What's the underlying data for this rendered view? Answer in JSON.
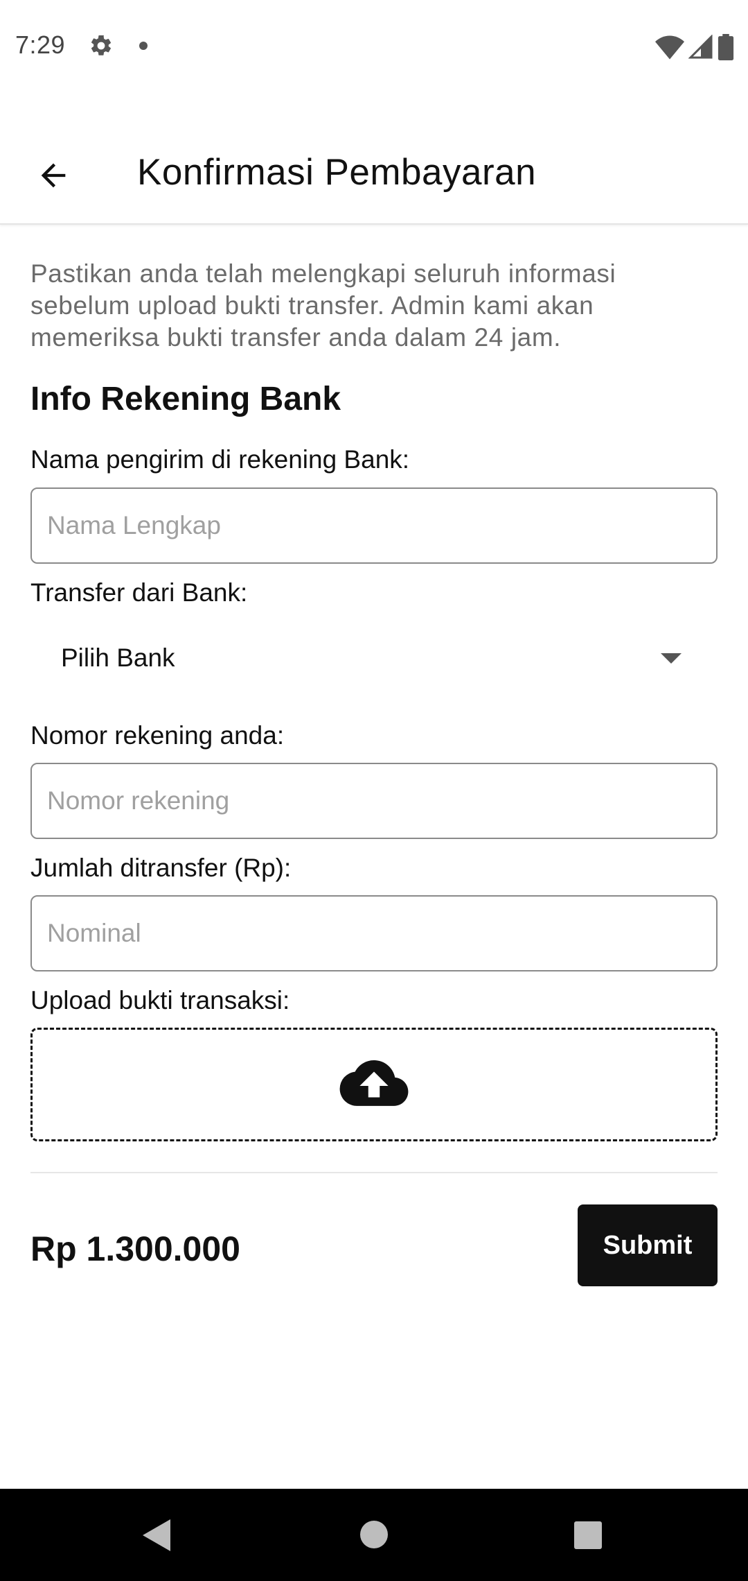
{
  "status_bar": {
    "time": "7:29",
    "icons": [
      "gear-icon",
      "dot-icon",
      "wifi-icon",
      "signal-icon",
      "battery-icon"
    ]
  },
  "app_bar": {
    "title": "Konfirmasi Pembayaran",
    "back_icon": "arrow-back-icon"
  },
  "intro_text": "Pastikan anda telah melengkapi seluruh informasi sebelum upload bukti transfer. Admin kami akan memeriksa bukti transfer anda dalam 24 jam.",
  "section_title": "Info Rekening Bank",
  "form": {
    "sender_name": {
      "label": "Nama pengirim di rekening Bank:",
      "placeholder": "Nama Lengkap",
      "value": ""
    },
    "bank": {
      "label": "Transfer dari Bank:",
      "selected": "Pilih Bank"
    },
    "account_number": {
      "label": "Nomor rekening anda:",
      "placeholder": "Nomor rekening",
      "value": ""
    },
    "amount": {
      "label": "Jumlah ditransfer (Rp):",
      "placeholder": "Nominal",
      "value": ""
    },
    "upload": {
      "label": "Upload bukti transaksi:",
      "icon": "cloud-upload-icon"
    }
  },
  "footer": {
    "total": "Rp 1.300.000",
    "submit_label": "Submit"
  },
  "colors": {
    "primary": "#111111",
    "muted_text": "#6b6b6b",
    "placeholder": "#a0a0a0",
    "border": "#8a8a8a"
  }
}
